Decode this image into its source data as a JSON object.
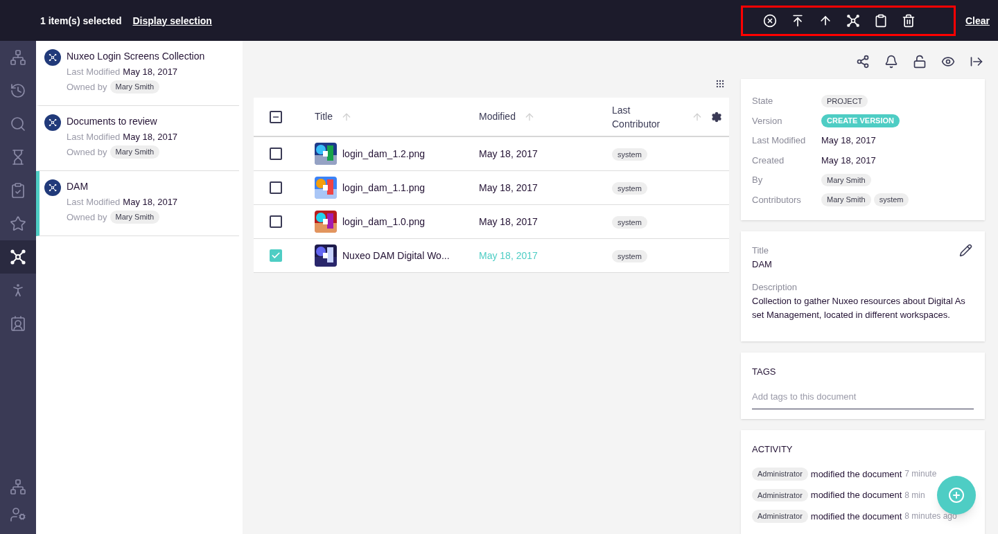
{
  "selection_bar": {
    "count": "1 item(s) selected",
    "display_link": "Display selection",
    "clear_link": "Clear",
    "highlighted": true
  },
  "nav": [
    {
      "selected": false
    },
    {
      "selected": false
    },
    {
      "selected": false
    },
    {
      "selected": false
    },
    {
      "selected": false
    },
    {
      "selected": false
    },
    {
      "selected": true
    },
    {
      "selected": false
    },
    {
      "selected": false
    }
  ],
  "collections": [
    {
      "title": "Nuxeo Login Screens Collection",
      "modified_label": "Last Modified",
      "modified": "May 18, 2017",
      "owner_label": "Owned by",
      "owner": "Mary Smith",
      "selected": false
    },
    {
      "title": "Documents to review",
      "modified_label": "Last Modified",
      "modified": "May 18, 2017",
      "owner_label": "Owned by",
      "owner": "Mary Smith",
      "selected": false
    },
    {
      "title": "DAM",
      "modified_label": "Last Modified",
      "modified": "May 18, 2017",
      "owner_label": "Owned by",
      "owner": "Mary Smith",
      "selected": true
    }
  ],
  "table": {
    "select_all": {
      "partial": true
    },
    "columns": [
      {
        "label": "Title"
      },
      {
        "label": "Modified"
      },
      {
        "label": "Last Contributor"
      }
    ],
    "rows": [
      {
        "title": "login_dam_1.2.png",
        "modified": "May 18, 2017",
        "contributor": "system",
        "checked": false
      },
      {
        "title": "login_dam_1.1.png",
        "modified": "May 18, 2017",
        "contributor": "system",
        "checked": false
      },
      {
        "title": "login_dam_1.0.png",
        "modified": "May 18, 2017",
        "contributor": "system",
        "checked": false
      },
      {
        "title": "Nuxeo DAM Digital Wo...",
        "modified": "May 18, 2017",
        "contributor": "system",
        "checked": true
      }
    ]
  },
  "metadata": [
    {
      "label": "State",
      "kind": "chip",
      "values": [
        "PROJECT"
      ]
    },
    {
      "label": "Version",
      "kind": "action",
      "values": [
        "CREATE VERSION"
      ]
    },
    {
      "label": "Last Modified",
      "kind": "text",
      "values": [
        "May 18, 2017"
      ]
    },
    {
      "label": "Created",
      "kind": "text",
      "values": [
        "May 18, 2017"
      ]
    },
    {
      "label": "By",
      "kind": "chip",
      "values": [
        "Mary Smith"
      ]
    },
    {
      "label": "Contributors",
      "kind": "chip",
      "values": [
        "Mary Smith",
        "system"
      ]
    }
  ],
  "info": {
    "title_label": "Title",
    "title": "DAM",
    "description_label": "Description",
    "description": "Collection to gather Nuxeo resources about Digital Asset Management, located in different workspaces."
  },
  "tags": {
    "heading": "TAGS",
    "placeholder": "Add tags to this document"
  },
  "activity": {
    "heading": "ACTIVITY",
    "items": [
      {
        "user": "Administrator",
        "action": "modified the document",
        "time": "7 minute"
      },
      {
        "user": "Administrator",
        "action": "modified the document",
        "time": "8 min"
      },
      {
        "user": "Administrator",
        "action": "modified the document",
        "time": "8 minutes ago"
      }
    ]
  }
}
